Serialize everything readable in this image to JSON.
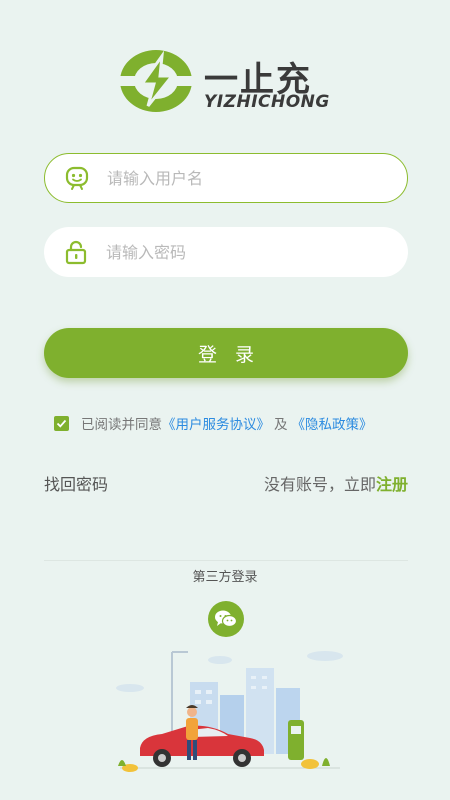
{
  "logo": {
    "cn_text": "一止充",
    "en_text": "YIZHICHONG"
  },
  "username": {
    "placeholder": "请输入用户名",
    "value": ""
  },
  "password": {
    "placeholder": "请输入密码",
    "value": ""
  },
  "login_button": {
    "label": "登录"
  },
  "agreement": {
    "checked": true,
    "prefix": "已阅读并同意",
    "service_link": "《用户服务协议》",
    "and": "及",
    "privacy_link": "《隐私政策》"
  },
  "forgot_password": "找回密码",
  "register": {
    "prompt": "没有账号，立即",
    "link": "注册"
  },
  "third_party": {
    "label": "第三方登录",
    "wechat_icon": "wechat-icon"
  },
  "colors": {
    "accent": "#7fb02e",
    "link": "#2c8be0",
    "background": "#eaf3f0"
  }
}
